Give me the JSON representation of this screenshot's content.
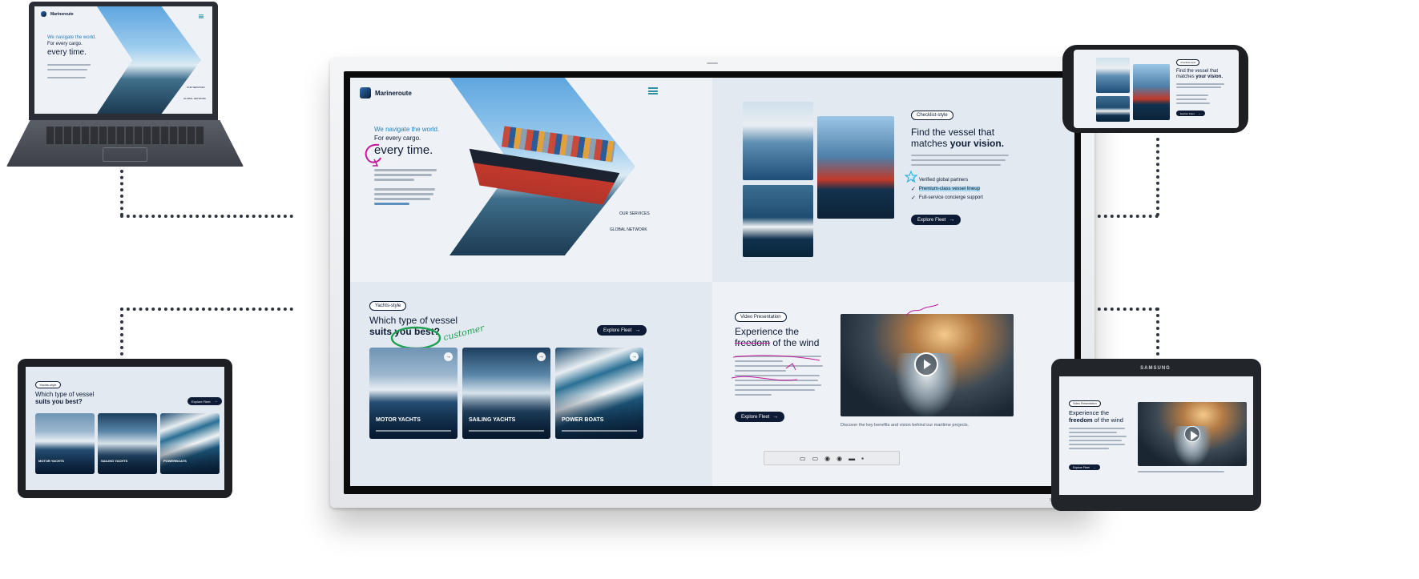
{
  "brand": {
    "logo_text": "Marineroute",
    "device_brand": "SAMSUNG"
  },
  "hero": {
    "line1": "We navigate the world.",
    "line2": "For every cargo.",
    "line3": "every time.",
    "nav_services": "OUR SERVICES",
    "nav_network": "GLOBAL NETWORK"
  },
  "vessel_match": {
    "tag": "Checklist-style",
    "title_plain": "Find the vessel that",
    "title_mid": "matches ",
    "title_bold": "your vision.",
    "checks": [
      "Verified global partners",
      "Premium-class vessel lineup",
      "Full-service concierge support"
    ],
    "cta": "Explore Fleet"
  },
  "yacht_types": {
    "tag": "Yachts-style",
    "title_plain": "Which type of vessel",
    "title_bold": "suits you best?",
    "cta": "Explore Fleet",
    "annotation": "customer",
    "cards": [
      {
        "label": "MOTOR YACHTS"
      },
      {
        "label": "SAILING YACHTS"
      },
      {
        "label": "POWER BOATS"
      }
    ]
  },
  "video": {
    "tag": "Video Presentation",
    "title_line1": "Experience the",
    "title_word": "freedom",
    "title_rest": " of the wind",
    "cta": "Explore Fleet",
    "caption": "Discover the key benefits and vision behind our maritime projects."
  },
  "tablet_left": {
    "tag": "Yachts-style",
    "title_plain": "Which type of vessel",
    "title_bold": "suits you best?",
    "cta": "Explore Fleet",
    "cards": [
      "MOTOR YACHTS",
      "SAILING YACHTS",
      "POWERBOATS"
    ]
  },
  "phone": {
    "tag": "Checklist-style",
    "title_plain": "Find the vessel that",
    "title_mid": "matches ",
    "title_bold": "your vision.",
    "cta": "Explore Fleet"
  },
  "tablet_right": {
    "tag": "Video Presentation",
    "title_line1": "Experience the",
    "title_word": "freedom",
    "title_rest": " of the wind",
    "cta": "Explore Fleet"
  },
  "colors": {
    "navy": "#0d1b34",
    "accent": "#2e7fb8",
    "marker_magenta": "#c2189b",
    "marker_green": "#1fa050",
    "marker_cyan": "#35b7e8"
  }
}
